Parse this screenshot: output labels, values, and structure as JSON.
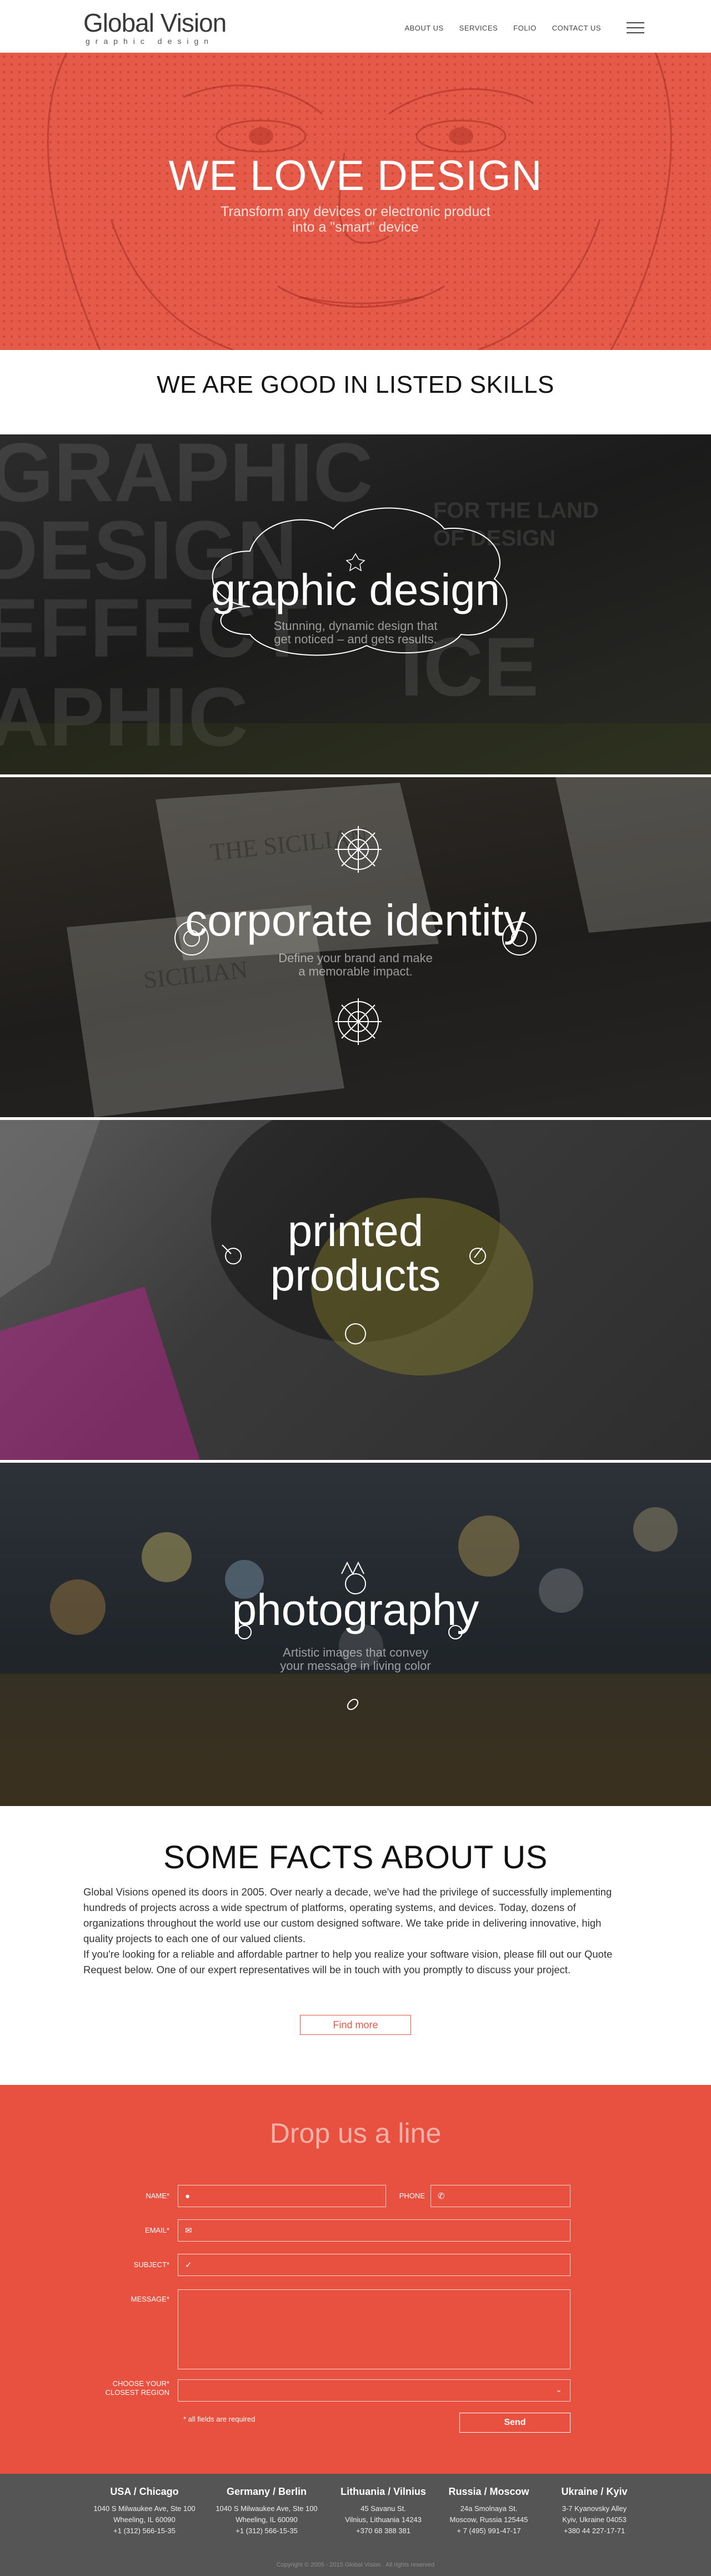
{
  "header": {
    "logo_title": "Global Vision",
    "logo_subtitle": "graphic design",
    "nav": [
      "ABOUT US",
      "SERVICES",
      "FOLIO",
      "CONTACT US"
    ]
  },
  "hero": {
    "title": "WE LOVE DESIGN",
    "subtitle_line1": "Transform any devices or electronic product",
    "subtitle_line2": "into a \"smart\" device"
  },
  "skills": {
    "heading": "WE ARE GOOD IN LISTED SKILLS",
    "items": [
      {
        "title": "graphic design",
        "sub_line1": "Stunning, dynamic design that",
        "sub_line2": "get noticed – and gets results."
      },
      {
        "title": "corporate identity",
        "sub_line1": "Define your brand and make",
        "sub_line2": "a memorable impact."
      },
      {
        "title_line1": "printed",
        "title_line2": "products"
      },
      {
        "title": "photography",
        "sub_line1": "Artistic images that convey",
        "sub_line2": "your message in living color"
      }
    ]
  },
  "facts": {
    "heading": "SOME FACTS ABOUT US",
    "paragraph1": "Global Visions opened its doors in 2005. Over nearly a decade, we've had the privilege of successfully implementing hundreds of projects across a wide spectrum of platforms, operating systems, and devices. Today, dozens of organizations throughout the world use our custom designed software. We take pride in delivering innovative, high quality projects to each one of our valued clients.",
    "paragraph2": "If you're looking for a reliable and affordable partner to help you realize your software vision, please fill out our Quote Request below. One of our expert representatives will be in touch with you promptly to discuss your project.",
    "button": "Find more"
  },
  "contact": {
    "title": "Drop us a line",
    "name_label": "NAME*",
    "phone_label": "PHONE",
    "email_label": "EMAIL*",
    "subject_label": "SUBJECT*",
    "message_label": "MESSAGE*",
    "region_label_line1": "CHOOSE YOUR*",
    "region_label_line2": "CLOSEST REGION",
    "required_note": "* all fields are required",
    "send": "Send"
  },
  "footer": {
    "offices": [
      {
        "city": "USA / Chicago",
        "lines": [
          "1040 S Milwaukee Ave, Ste 100",
          "Wheeling, IL 60090",
          "+1 (312) 566-15-35"
        ]
      },
      {
        "city": "Germany / Berlin",
        "lines": [
          "1040 S Milwaukee Ave, Ste 100",
          "Wheeling, IL 60090",
          "+1 (312) 566-15-35"
        ]
      },
      {
        "city": "Lithuania / Vilnius",
        "lines": [
          "45 Savanu St.",
          "Vilnius, Lithuania 14243",
          "+370 68 388 381"
        ]
      },
      {
        "city": "Russia / Moscow",
        "lines": [
          "24a Smolnaya St.",
          "Moscow, Russia 125445",
          "+ 7 (495) 991-47-17"
        ]
      },
      {
        "city": "Ukraine / Kyiv",
        "lines": [
          "3-7 Kyanovsky Alley",
          "Kyiv, Ukraine 04053",
          "+380 44 227-17-71"
        ]
      }
    ],
    "copyright": "Copyright © 2005 - 2015 Global Vision . All rights reserved"
  },
  "colors": {
    "accent": "#e8503f",
    "hero": "#e55a48",
    "footer": "#555555"
  }
}
